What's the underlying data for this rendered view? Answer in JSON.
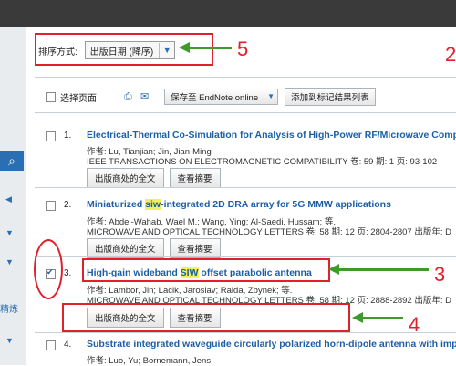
{
  "sort": {
    "label": "排序方式:",
    "value": "出版日期 (降序)"
  },
  "toolbar": {
    "select_page": "选择页面",
    "endnote": "保存至 EndNote online",
    "add_marked": "添加到标记结果列表"
  },
  "annotations": {
    "n2": "2",
    "n3": "3",
    "n4": "4",
    "n5": "5"
  },
  "left_label": "精炼",
  "records": [
    {
      "num": "1.",
      "title": "Electrical-Thermal Co-Simulation for Analysis of High-Power RF/Microwave Compone",
      "authors": "作者: Lu, Tianjian; Jin, Jian-Ming",
      "source": "IEEE TRANSACTIONS ON ELECTROMAGNETIC COMPATIBILITY  卷: 59  期: 1  页: 93-102",
      "btn_fulltext": "出版商处的全文",
      "btn_abstract": "查看摘要"
    },
    {
      "num": "2.",
      "title_pre": "Miniaturized ",
      "title_hl": "siw",
      "title_post": "-integrated 2D DRA array for 5G MMW applications",
      "authors": "作者: Abdel-Wahab, Wael M.; Wang, Ying; Al-Saedi, Hussam; 等.",
      "source": "MICROWAVE AND OPTICAL TECHNOLOGY LETTERS  卷: 58  期: 12  页: 2804-2807  出版年: D",
      "btn_fulltext": "出版商处的全文",
      "btn_abstract": "查看摘要"
    },
    {
      "num": "3.",
      "title_pre": "High-gain wideband ",
      "title_hl": "SIW",
      "title_post": " offset parabolic antenna",
      "authors": "作者: Lambor, Jin; Lacik, Jaroslav; Raida, Zbynek; 等.",
      "source": "MICROWAVE AND OPTICAL TECHNOLOGY LETTERS  卷: 58  期: 12  页: 2888-2892  出版年: D",
      "btn_fulltext": "出版商处的全文",
      "btn_abstract": "查看摘要"
    },
    {
      "num": "4.",
      "title": "Substrate integrated waveguide circularly polarized horn-dipole antenna with improv",
      "authors": "作者: Luo, Yu; Bornemann, Jens"
    }
  ],
  "colors": {
    "accent": "#1d5ea8",
    "annotation_red": "#e0202a",
    "annotation_green": "#3f9a2b",
    "highlight": "#f4f05a"
  }
}
